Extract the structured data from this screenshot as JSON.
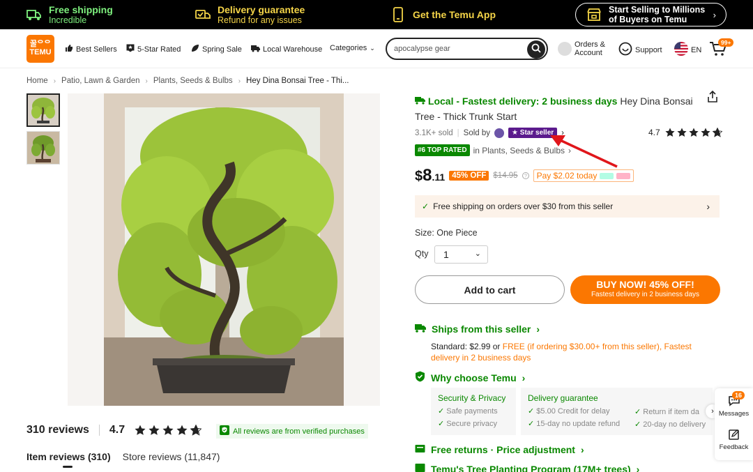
{
  "promo": {
    "free_shipping": {
      "title": "Free shipping",
      "subtitle": "Incredible"
    },
    "delivery": {
      "title": "Delivery guarantee",
      "subtitle": "Refund for any issues"
    },
    "app": {
      "title": "Get the Temu App"
    },
    "sell": {
      "line1": "Start Selling to Millions",
      "line2": "of Buyers on Temu"
    }
  },
  "nav": {
    "logo_line1": "꿀ᄋᄋ",
    "logo_line2": "TEMU",
    "links": [
      "Best Sellers",
      "5-Star Rated",
      "Spring Sale",
      "Local Warehouse",
      "Categories"
    ],
    "search_value": "apocalypse gear",
    "orders_line1": "Orders &",
    "orders_line2": "Account",
    "support": "Support",
    "language": "EN",
    "cart_badge": "99+"
  },
  "breadcrumb": [
    "Home",
    "Patio, Lawn & Garden",
    "Plants, Seeds & Bulbs",
    "Hey Dina Bonsai Tree - Thi..."
  ],
  "product": {
    "local_delivery": "Local - Fastest delivery: 2 business days",
    "title": "Hey Dina Bonsai Tree - Thick Trunk Start",
    "sold": "3.1K+ sold",
    "sold_by": "Sold by",
    "star_seller": "Star seller",
    "rating": "4.7",
    "rating_stars": 4.7,
    "top_rated_badge": "#6 TOP RATED",
    "top_rated_category": "in Plants, Seeds & Bulbs",
    "price_currency": "$",
    "price_int": "8",
    "price_dec": ".11",
    "discount": "45% OFF",
    "old_price": "$14.95",
    "pay_today": "Pay $2.02 today",
    "free_ship_notice": "Free shipping on orders over $30 from this seller",
    "size": "Size: One Piece",
    "qty_label": "Qty",
    "qty_value": "1",
    "add_to_cart": "Add to cart",
    "buy_now": "BUY NOW! 45% OFF!",
    "buy_now_sub": "Fastest delivery in 2 business days"
  },
  "shipping": {
    "ships_from": "Ships from this seller",
    "standard_prefix": "Standard: $2.99 or ",
    "standard_free": "FREE (if ordering $30.00+ from this seller),",
    "standard_fast": "Fastest delivery in 2 business days"
  },
  "why": {
    "title": "Why choose Temu",
    "security": {
      "title": "Security & Privacy",
      "items": [
        "Safe payments",
        "Secure privacy"
      ]
    },
    "delivery": {
      "title": "Delivery guarantee",
      "items": [
        "$5.00 Credit for delay",
        "15-day no update refund"
      ],
      "items_right": [
        "Return if item da",
        "20-day no delivery"
      ]
    }
  },
  "free_returns": "Free returns · Price adjustment",
  "tree_program": "Temu's Tree Planting Program (17M+ trees)",
  "reviews": {
    "count": "310 reviews",
    "rating": "4.7",
    "verified": "All reviews are from verified purchases",
    "tab_item": "Item reviews (310)",
    "tab_store": "Store reviews (11,847)"
  },
  "float": {
    "messages": "Messages",
    "messages_badge": "16",
    "feedback": "Feedback"
  },
  "colors": {
    "brand_orange": "#fb7701",
    "green": "#0a8800",
    "star_seller_purple": "#5b1a8d",
    "annotation_red": "#e0161b"
  },
  "icons": [
    "truck-icon",
    "shield-truck-icon",
    "phone-icon",
    "store-icon",
    "thumbs-up-icon",
    "star-badge-icon",
    "leaf-icon",
    "warehouse-truck-icon",
    "search-icon",
    "chat-icon",
    "flag-icon",
    "cart-icon",
    "share-icon",
    "check-icon",
    "chevron-right-icon",
    "shield-check-icon",
    "return-icon",
    "tree-icon",
    "feedback-icon"
  ]
}
